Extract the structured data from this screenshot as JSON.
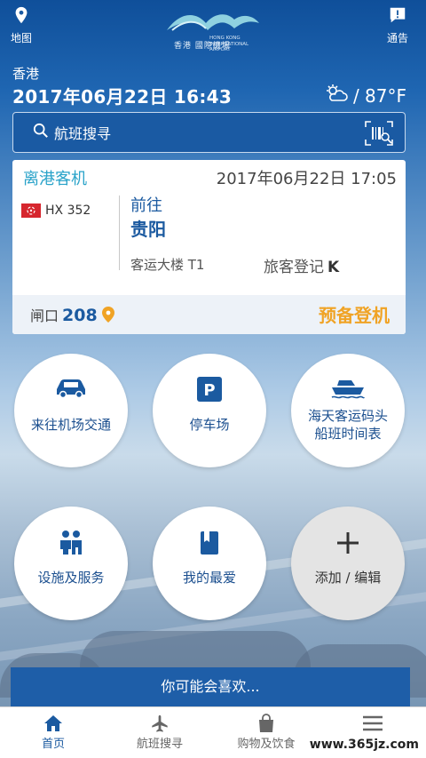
{
  "topbar": {
    "map_label": "地图",
    "notice_label": "通告",
    "logo_cn": "香港 國際機場",
    "logo_en": "HONG KONG INTERNATIONAL AIRPORT"
  },
  "header": {
    "location": "香港",
    "datetime": "2017年06月22日 16:43",
    "weather": "/ 87°F"
  },
  "search": {
    "placeholder": "航班搜寻"
  },
  "flight_card": {
    "type": "离港客机",
    "time": "2017年06月22日 17:05",
    "flight_no": "HX 352",
    "dest_prefix": "前往",
    "dest_city": "贵阳",
    "terminal": "客运大楼 T1",
    "checkin_label": "旅客登记",
    "checkin_value": "K",
    "gate_label": "闸口",
    "gate_value": "208",
    "status": "预备登机",
    "status_color": "#f0a325"
  },
  "tiles": [
    {
      "label": "来往机场交通",
      "icon": "car-icon"
    },
    {
      "label": "停车场",
      "icon": "parking-icon"
    },
    {
      "label": "海天客运码头船班时间表",
      "line1": "海天客运码头",
      "line2": "船班时间表",
      "icon": "ferry-icon"
    },
    {
      "label": "设施及服务",
      "icon": "people-icon"
    },
    {
      "label": "我的最爱",
      "icon": "bookmark-icon"
    },
    {
      "label": "添加 / 编辑",
      "icon": "plus-icon"
    }
  ],
  "suggest": {
    "label": "你可能会喜欢..."
  },
  "nav": {
    "items": [
      {
        "label": "首页",
        "icon": "home-icon"
      },
      {
        "label": "航班搜寻",
        "icon": "plane-icon"
      },
      {
        "label": "购物及饮食",
        "icon": "shopping-bag-icon"
      },
      {
        "label": "",
        "icon": "menu-icon"
      }
    ]
  },
  "watermark": "www.365jz.com",
  "colors": {
    "brand_blue": "#1b5aa0",
    "accent_teal": "#2aa3c9",
    "status_orange": "#f0a325"
  }
}
